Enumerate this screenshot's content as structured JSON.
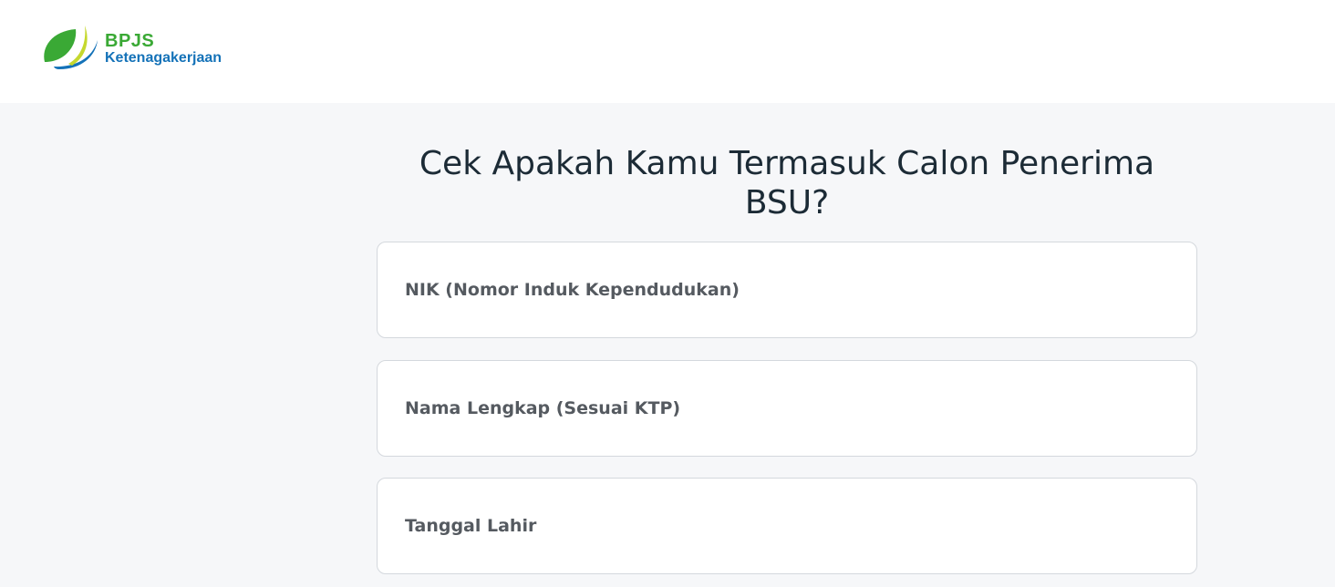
{
  "header": {
    "logo": {
      "brand": "BPJS",
      "sub": "Ketenagakerjaan",
      "icon": "bpjs-leaf-logo",
      "colors": {
        "green": "#3aa935",
        "blue": "#1472b8",
        "lime": "#c5d82e"
      }
    }
  },
  "main": {
    "title": "Cek Apakah Kamu Termasuk Calon Penerima BSU?",
    "fields": [
      {
        "label": "NIK (Nomor Induk Kependudukan)"
      },
      {
        "label": "Nama Lengkap (Sesuai KTP)"
      },
      {
        "label": "Tanggal Lahir"
      }
    ]
  },
  "colors": {
    "page_background": "#f6f7f9",
    "header_background": "#ffffff",
    "title_text": "#1c2b36",
    "label_text": "#555a60",
    "field_border": "#d4d8dd"
  }
}
